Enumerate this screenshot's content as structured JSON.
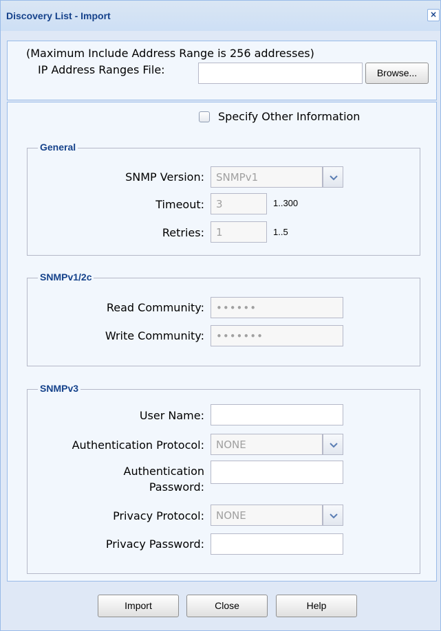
{
  "window": {
    "title": "Discovery List - Import",
    "close_glyph": "×"
  },
  "import_file": {
    "note": "(Maximum Include Address Range is 256 addresses)",
    "label": "IP Address Ranges File:",
    "value": "",
    "browse_label": "Browse..."
  },
  "specify_other": {
    "label": "Specify Other Information",
    "checked": false
  },
  "general": {
    "legend": "General",
    "snmp_version_label": "SNMP Version:",
    "snmp_version_value": "SNMPv1",
    "timeout_label": "Timeout:",
    "timeout_value": "3",
    "timeout_range": "1..300",
    "retries_label": "Retries:",
    "retries_value": "1",
    "retries_range": "1..5"
  },
  "snmpv12c": {
    "legend": "SNMPv1/2c",
    "read_label": "Read Community:",
    "read_value": "••••••",
    "write_label": "Write Community:",
    "write_value": "•••••••"
  },
  "snmpv3": {
    "legend": "SNMPv3",
    "user_label": "User Name:",
    "user_value": "",
    "auth_protocol_label": "Authentication Protocol:",
    "auth_protocol_value": "NONE",
    "auth_password_label_1": "Authentication",
    "auth_password_label_2": "Password:",
    "auth_password_value": "",
    "privacy_protocol_label": "Privacy Protocol:",
    "privacy_protocol_value": "NONE",
    "privacy_password_label": "Privacy Password:",
    "privacy_password_value": ""
  },
  "footer": {
    "import_label": "Import",
    "close_label": "Close",
    "help_label": "Help"
  },
  "colors": {
    "title": "#15428b",
    "border": "#99bbe8",
    "background": "#dfe8f6"
  }
}
